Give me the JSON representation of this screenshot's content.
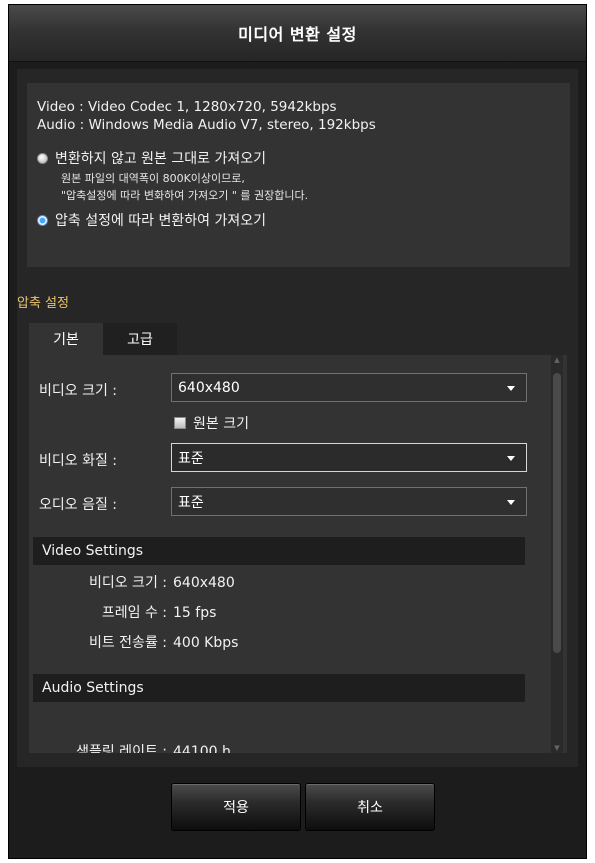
{
  "dialog": {
    "title": "미디어 변환 설정"
  },
  "info": {
    "video": "Video : Video Codec 1, 1280x720, 5942kbps",
    "audio": "Audio : Windows Media Audio V7, stereo, 192kbps",
    "option_original": "변환하지 않고 원본 그대로 가져오기",
    "note_line1": "원본 파일의 대역폭이 800K이상이므로,",
    "note_line2": "\"압축설정에 따라 변화하여 가져오기 \" 를  권장합니다.",
    "option_convert": "압축 설정에 따라 변환하여 가져오기",
    "selected_option": "convert"
  },
  "compression": {
    "section_label": "압축 설정",
    "tabs": [
      {
        "label": "기본"
      },
      {
        "label": "고급"
      }
    ],
    "active_tab": "기본",
    "video_size": {
      "label": "비디오 크기 :",
      "value": "640x480"
    },
    "original_size": {
      "label": "원본 크기",
      "checked": false
    },
    "video_quality": {
      "label": "비디오 화질 :",
      "value": "표준"
    },
    "audio_quality": {
      "label": "오디오 음질 :",
      "value": "표준"
    },
    "video_settings": {
      "header": "Video Settings",
      "rows": [
        {
          "key": "비디오 크기 :",
          "value": "640x480"
        },
        {
          "key": "프레임 수 :",
          "value": "15 fps"
        },
        {
          "key": "비트 전송률 :",
          "value": "400 Kbps"
        }
      ]
    },
    "audio_settings": {
      "header": "Audio Settings",
      "partial_row_key": "샘플링 레이트 :",
      "partial_row_value": "44100 h"
    }
  },
  "buttons": {
    "apply": "적용",
    "cancel": "취소"
  },
  "colors": {
    "accent_label": "#e9c46a",
    "radio_selected": "#3fa8ff",
    "dialog_bg": "#1c1c1c"
  }
}
